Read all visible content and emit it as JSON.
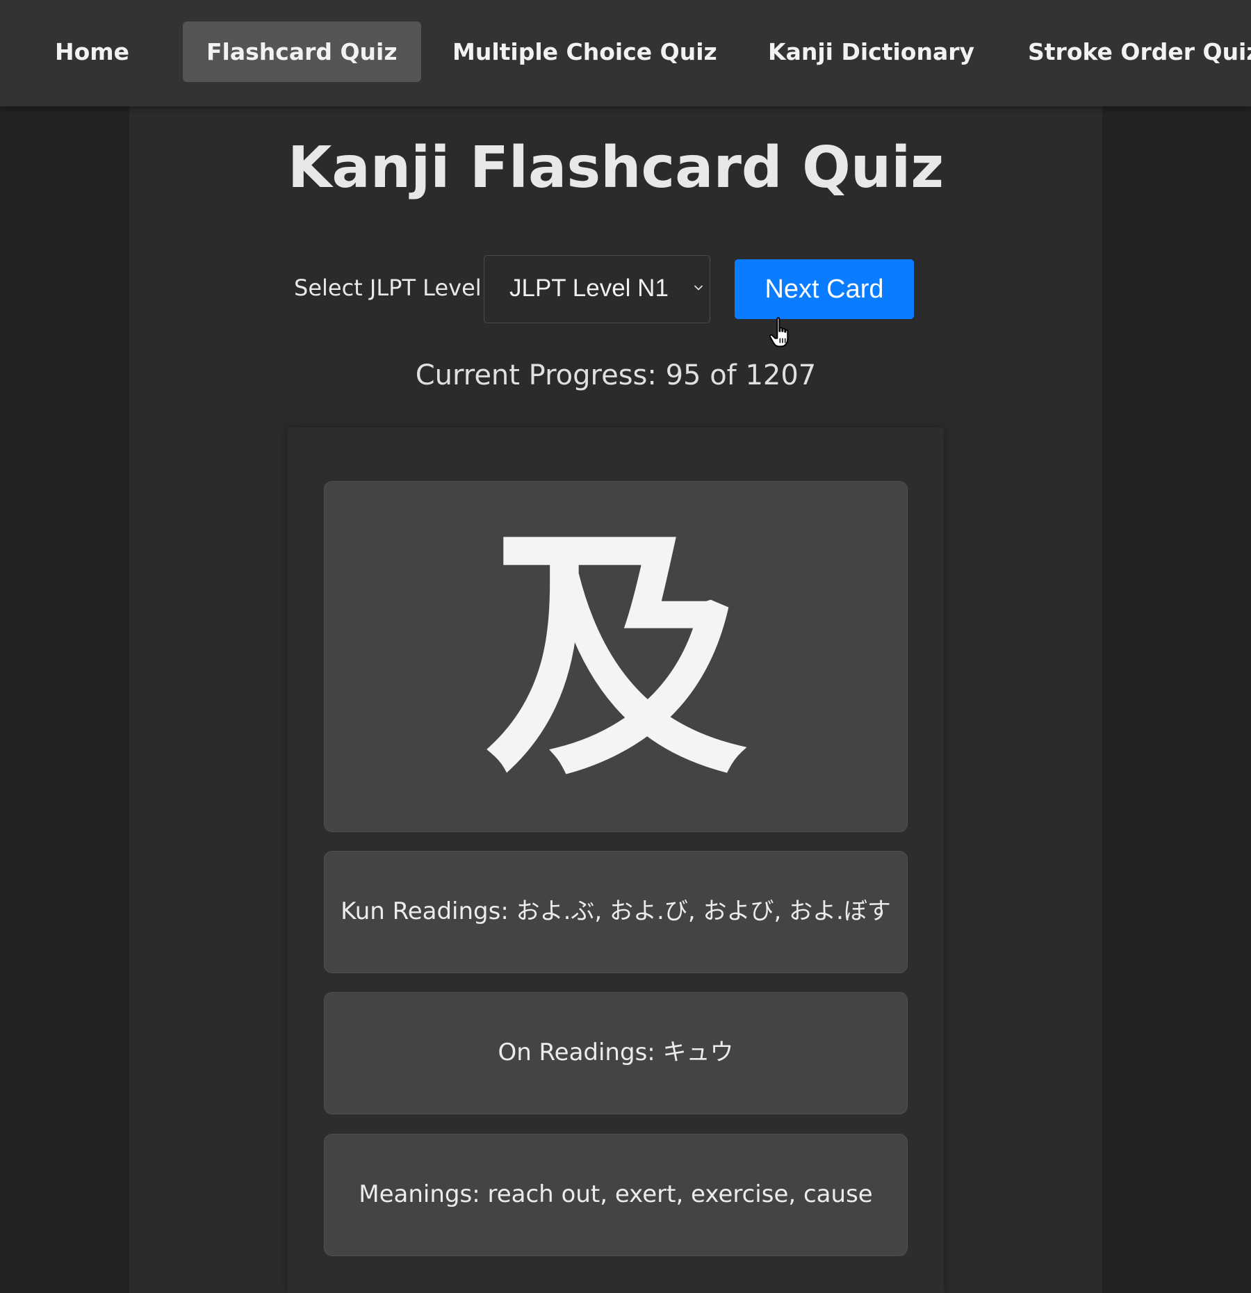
{
  "nav": {
    "items": [
      {
        "label": "Home"
      },
      {
        "label": "Flashcard Quiz",
        "active": true
      },
      {
        "label": "Multiple Choice Quiz"
      },
      {
        "label": "Kanji Dictionary"
      },
      {
        "label": "Stroke Order Quiz"
      }
    ]
  },
  "page": {
    "title": "Kanji Flashcard Quiz"
  },
  "controls": {
    "level_label": "Select JLPT Level:",
    "level_selected": "JLPT Level N1",
    "next_label": "Next Card"
  },
  "progress": {
    "text": "Current Progress: 95 of 1207"
  },
  "card": {
    "kanji": "及",
    "kun_readings": "Kun Readings: およ.ぶ, およ.び, および, およ.ぼす",
    "on_readings": "On Readings: キュウ",
    "meanings": "Meanings: reach out, exert, exercise, cause"
  },
  "colors": {
    "nav_bg": "#333333",
    "nav_active_bg": "#555555",
    "page_bg": "#222222",
    "panel_bg": "#2b2b2b",
    "card_box_bg": "#444444",
    "accent_button": "#0a7cff"
  },
  "icons": {
    "select_arrow": "chevron-down-icon",
    "cursor": "hand-pointer-icon"
  }
}
